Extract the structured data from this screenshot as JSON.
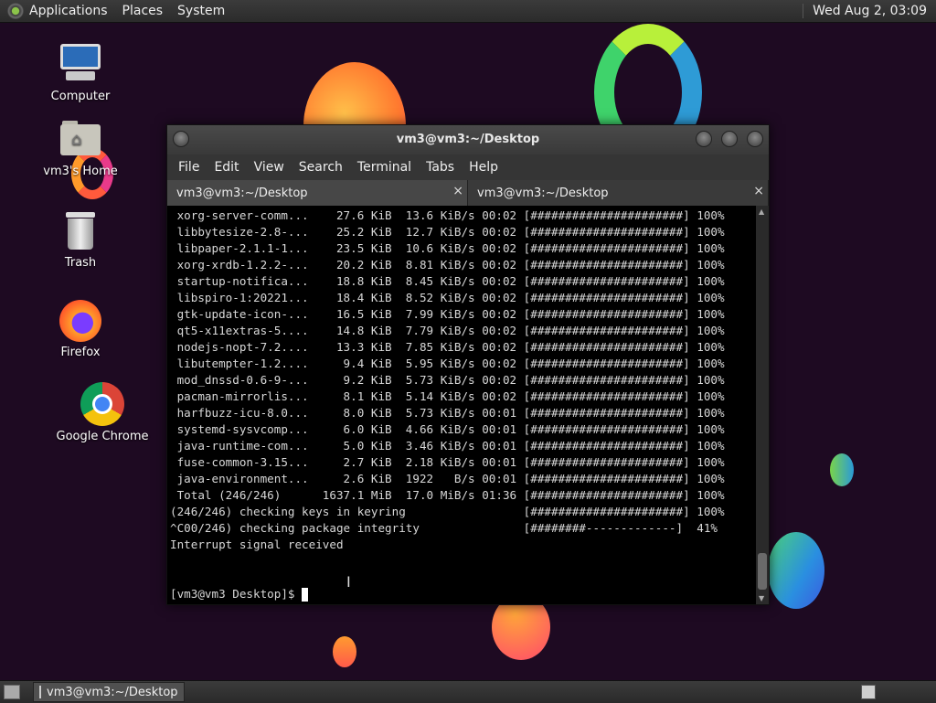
{
  "top_panel": {
    "menus": [
      "Applications",
      "Places",
      "System"
    ],
    "clock": "Wed Aug  2, 03:09"
  },
  "desktop_icons": [
    {
      "label": "Computer",
      "icon": "computer-icon"
    },
    {
      "label": "vm3's Home",
      "icon": "home-folder-icon"
    },
    {
      "label": "Trash",
      "icon": "trash-icon"
    },
    {
      "label": "Firefox",
      "icon": "firefox-icon"
    },
    {
      "label": "Google Chrome",
      "icon": "chrome-icon"
    }
  ],
  "window": {
    "title": "vm3@vm3:~/Desktop",
    "menu": [
      "File",
      "Edit",
      "View",
      "Search",
      "Terminal",
      "Tabs",
      "Help"
    ],
    "tabs": [
      {
        "label": "vm3@vm3:~/Desktop",
        "close": "×"
      },
      {
        "label": "vm3@vm3:~/Desktop",
        "close": "×"
      }
    ]
  },
  "terminal": {
    "lines": [
      " xorg-server-comm...    27.6 KiB  13.6 KiB/s 00:02 [######################] 100%",
      " libbytesize-2.8-...    25.2 KiB  12.7 KiB/s 00:02 [######################] 100%",
      " libpaper-2.1.1-1...    23.5 KiB  10.6 KiB/s 00:02 [######################] 100%",
      " xorg-xrdb-1.2.2-...    20.2 KiB  8.81 KiB/s 00:02 [######################] 100%",
      " startup-notifica...    18.8 KiB  8.45 KiB/s 00:02 [######################] 100%",
      " libspiro-1:20221...    18.4 KiB  8.52 KiB/s 00:02 [######################] 100%",
      " gtk-update-icon-...    16.5 KiB  7.99 KiB/s 00:02 [######################] 100%",
      " qt5-x11extras-5....    14.8 KiB  7.79 KiB/s 00:02 [######################] 100%",
      " nodejs-nopt-7.2....    13.3 KiB  7.85 KiB/s 00:02 [######################] 100%",
      " libutempter-1.2....     9.4 KiB  5.95 KiB/s 00:02 [######################] 100%",
      " mod_dnssd-0.6-9-...     9.2 KiB  5.73 KiB/s 00:02 [######################] 100%",
      " pacman-mirrorlis...     8.1 KiB  5.14 KiB/s 00:02 [######################] 100%",
      " harfbuzz-icu-8.0...     8.0 KiB  5.73 KiB/s 00:01 [######################] 100%",
      " systemd-sysvcomp...     6.0 KiB  4.66 KiB/s 00:01 [######################] 100%",
      " java-runtime-com...     5.0 KiB  3.46 KiB/s 00:01 [######################] 100%",
      " fuse-common-3.15...     2.7 KiB  2.18 KiB/s 00:01 [######################] 100%",
      " java-environment...     2.6 KiB  1922   B/s 00:01 [######################] 100%",
      " Total (246/246)      1637.1 MiB  17.0 MiB/s 01:36 [######################] 100%",
      "(246/246) checking keys in keyring                 [######################] 100%",
      "^C00/246) checking package integrity               [########-------------]  41%",
      "Interrupt signal received",
      "",
      ""
    ],
    "prompt": "[vm3@vm3 Desktop]$ "
  },
  "taskbar": {
    "task_label": "vm3@vm3:~/Desktop"
  }
}
